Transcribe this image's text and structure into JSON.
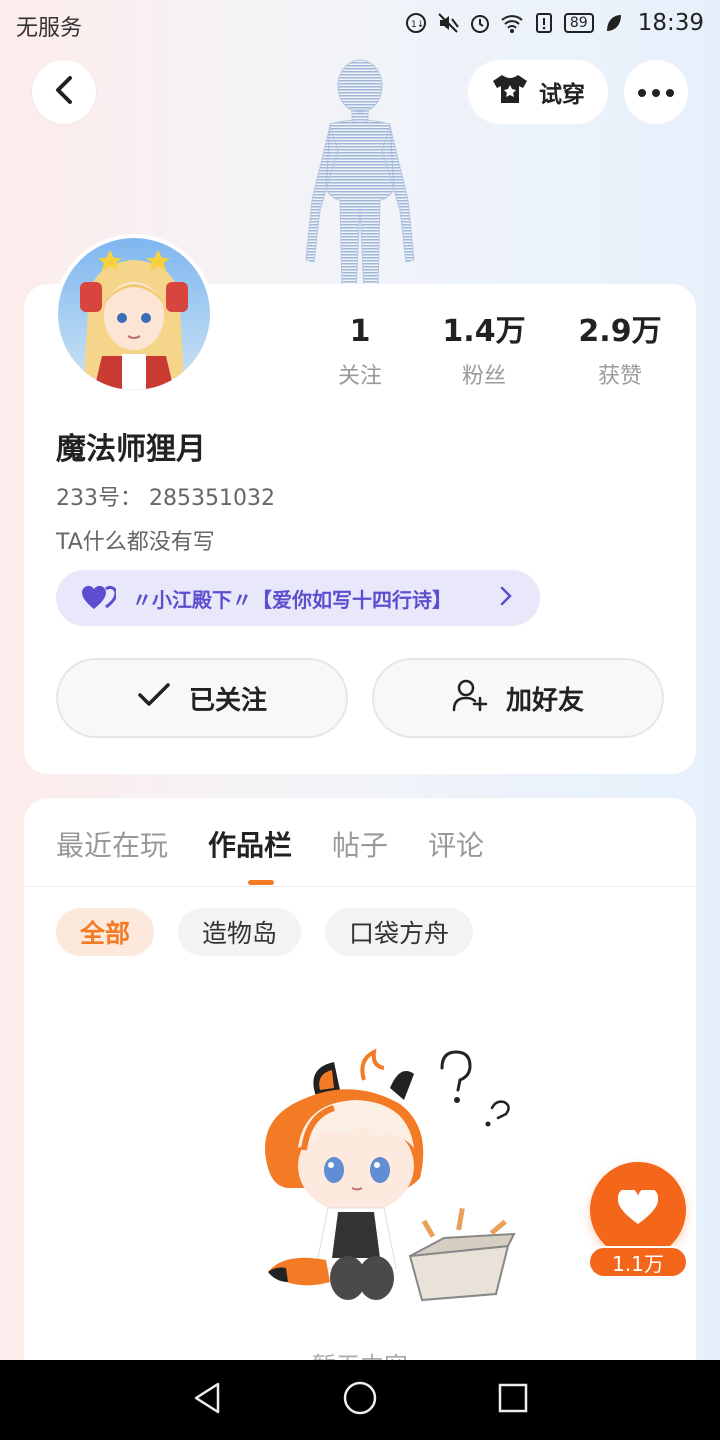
{
  "status_bar": {
    "carrier": "无服务",
    "battery": "89",
    "time": "18:39"
  },
  "header": {
    "tryon_label": "试穿"
  },
  "profile": {
    "stats": [
      {
        "value": "1",
        "label": "关注"
      },
      {
        "value": "1.4万",
        "label": "粉丝"
      },
      {
        "value": "2.9万",
        "label": "获赞"
      }
    ],
    "username": "魔法师狸月",
    "user_id": "233号： 285351032",
    "bio": "TA什么都没有写",
    "couple_tag": "〃小江殿下〃【爱你如写十四行诗】",
    "follow_button": "已关注",
    "add_friend_button": "加好友"
  },
  "works": {
    "tabs": [
      {
        "label": "最近在玩",
        "active": false
      },
      {
        "label": "作品栏",
        "active": true
      },
      {
        "label": "帖子",
        "active": false
      },
      {
        "label": "评论",
        "active": false
      }
    ],
    "chips": [
      {
        "label": "全部",
        "active": true
      },
      {
        "label": "造物岛",
        "active": false
      },
      {
        "label": "口袋方舟",
        "active": false
      }
    ],
    "empty_text": "暂无内容"
  },
  "like_fab": {
    "count": "1.1万"
  },
  "colors": {
    "accent": "#f47b25",
    "like": "#f4661a",
    "couple": "#5b4fd0"
  }
}
